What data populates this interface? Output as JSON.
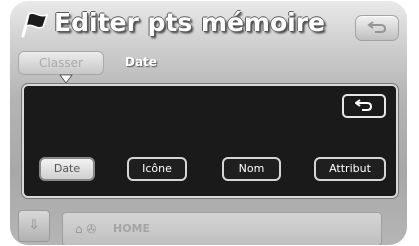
{
  "header": {
    "title": "Editer pts mémoire",
    "icon": "flag-icon",
    "back_icon": "return-arrow-icon"
  },
  "sort": {
    "button_label": "Classer",
    "current_value": "Date"
  },
  "panel": {
    "back_icon": "return-arrow-icon",
    "options": [
      {
        "label": "Date",
        "selected": true
      },
      {
        "label": "Icône",
        "selected": false
      },
      {
        "label": "Nom",
        "selected": false
      },
      {
        "label": "Attribut",
        "selected": false
      }
    ]
  },
  "list": {
    "scroll_icon": "scroll-down-icon",
    "item_icons": "house-icon car-icon",
    "item_label": "HOME"
  }
}
